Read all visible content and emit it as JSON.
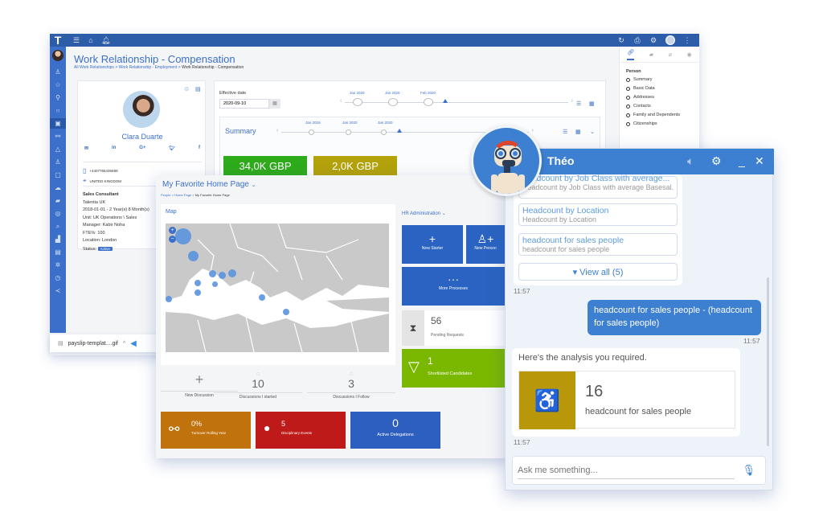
{
  "app": {
    "logo": "T",
    "topbar_icons_left": [
      "menu-icon",
      "home-icon",
      "bell-icon"
    ],
    "topbar_icons_right": [
      "refresh-icon",
      "print-icon",
      "gear-icon",
      "robot-avatar",
      "more-vert-icon"
    ],
    "title": "Work Relationship - Compensation",
    "breadcrumb": [
      "All Work Relationships",
      "Work Relationship - Employment",
      "Work Relationship - Compensation"
    ],
    "sidenav_icons": [
      "people-icon",
      "star-icon",
      "org-icon",
      "circle-icon",
      "money-icon",
      "hierarchy-icon",
      "bell-icon",
      "user-add-icon",
      "calendar-icon",
      "cloud-icon",
      "car-icon",
      "coins-icon",
      "search-icon",
      "chart-icon",
      "document-icon",
      "gear-icon",
      "clock-icon",
      "share-icon"
    ]
  },
  "profile": {
    "name": "Clara Duarte",
    "social": [
      "✉",
      "in",
      "G+",
      "🐦",
      "f"
    ],
    "phone": "+4407765435688",
    "country": "UNITED KINGDOM",
    "job_title": "Sales Consultant",
    "company": "Talentia UK",
    "period": "2018-01-01 - 2 Year(s) 8 Month(s)",
    "unit": "Unit: UK Operations \\ Sales",
    "manager": "Manager: Kabir Noha",
    "fte": "FTE%: 100",
    "location": "Location: London",
    "status_label": "Status:",
    "status": "Active"
  },
  "compensation": {
    "effective_date_label": "Effective date",
    "effective_date": "2020-09-10",
    "timeline_top": [
      "Jan 2020",
      "Jan 2020",
      "Feb 2020"
    ],
    "summary_title": "Summary",
    "timeline_summary": [
      "Jan 2018",
      "Jan 2020",
      "Jan 2020"
    ],
    "kpis": [
      {
        "value": "34,0K GBP",
        "color": "#2eab1b"
      },
      {
        "value": "2,0K GBP",
        "color": "#b3a20a"
      }
    ]
  },
  "right_panel": {
    "tabs": [
      "link-icon",
      "chat-icon",
      "clip-icon",
      "compass-icon"
    ],
    "heading": "Person",
    "items": [
      "Summary",
      "Basic Data",
      "Addresses",
      "Contacts",
      "Family and Dependents",
      "Citizenships"
    ]
  },
  "download": {
    "file": "payslip-templat....gif"
  },
  "home": {
    "title": "My Favorite Home Page",
    "breadcrumb": [
      "People",
      "Home Page",
      "My Favorite Home Page"
    ],
    "map_title": "Map",
    "discussions": [
      {
        "value": "+",
        "label": "New Discussion"
      },
      {
        "value": "10",
        "label": "Discussions I started"
      },
      {
        "value": "3",
        "label": "Discussions I Follow"
      }
    ],
    "stats": [
      {
        "value": "0%",
        "label": "Turnover Rolling Year",
        "color": "#c0720c"
      },
      {
        "value": "5",
        "label": "Disciplinary Events",
        "color": "#bf1a1a"
      },
      {
        "value": "0",
        "label": "Active Delegations",
        "color": "#2d5fc0"
      }
    ],
    "hr_admin": "HR Administration",
    "tiles": {
      "new_starter": "New Starter",
      "new_person": "New Person",
      "more_processes": "More Processes"
    },
    "pending_value": "56",
    "pending_label": "Pending Requests",
    "shortlist_value": "1",
    "shortlist_label": "Shortlisted Candidates"
  },
  "chat": {
    "name": "Théo",
    "suggestions": [
      {
        "title": "headcount by Job Class with average...",
        "sub": "Headcount by Job Class with average Basesal..."
      },
      {
        "title": "Headcount by Location",
        "sub": "Headcount by Location"
      },
      {
        "title": "headcount for sales people",
        "sub": "headcount for sales people"
      }
    ],
    "view_all": "View all (5)",
    "ts1": "11:57",
    "user_message": "headcount for sales people - (headcount for sales people)",
    "ts2": "11:57",
    "bot_text": "Here's the analysis you required.",
    "result_value": "16",
    "result_label": "headcount for sales people",
    "ts3": "11:57",
    "input_placeholder": "Ask me something..."
  }
}
